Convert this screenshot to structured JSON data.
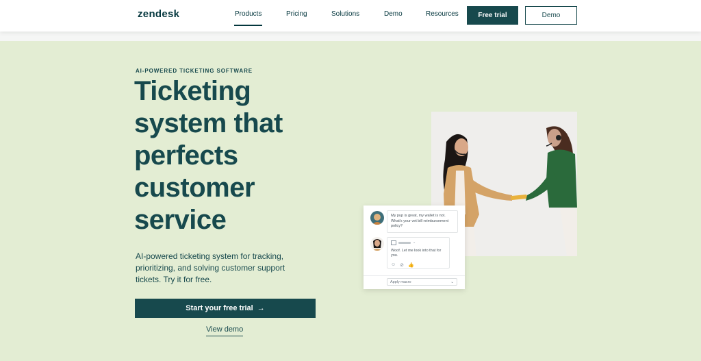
{
  "brand": {
    "logo": "zendesk"
  },
  "nav": {
    "items": [
      {
        "label": "Products",
        "active": true
      },
      {
        "label": "Pricing"
      },
      {
        "label": "Solutions"
      },
      {
        "label": "Demo"
      },
      {
        "label": "Resources"
      }
    ],
    "free_trial": "Free trial",
    "demo": "Demo"
  },
  "hero": {
    "eyebrow": "AI-POWERED TICKETING SOFTWARE",
    "headline_lines": [
      "Ticketing",
      "system that",
      "perfects",
      "customer",
      "service"
    ],
    "subtext": "AI-powered ticketing system for tracking, prioritizing, and solving customer support tickets. Try it for free.",
    "cta": "Start your free trial",
    "cta_arrow": "→",
    "view_demo": "View demo"
  },
  "chat": {
    "customer_message": "My pup is great, my wallet is not. What's your vet bill reimbursement policy?",
    "agent_message": "Woof. Let me look into that for you.",
    "macro_placeholder": "Apply macro",
    "macro_chevron": "⌄"
  },
  "colors": {
    "brand_dark": "#17494d",
    "hero_bg": "#e3edd3",
    "white": "#ffffff"
  }
}
